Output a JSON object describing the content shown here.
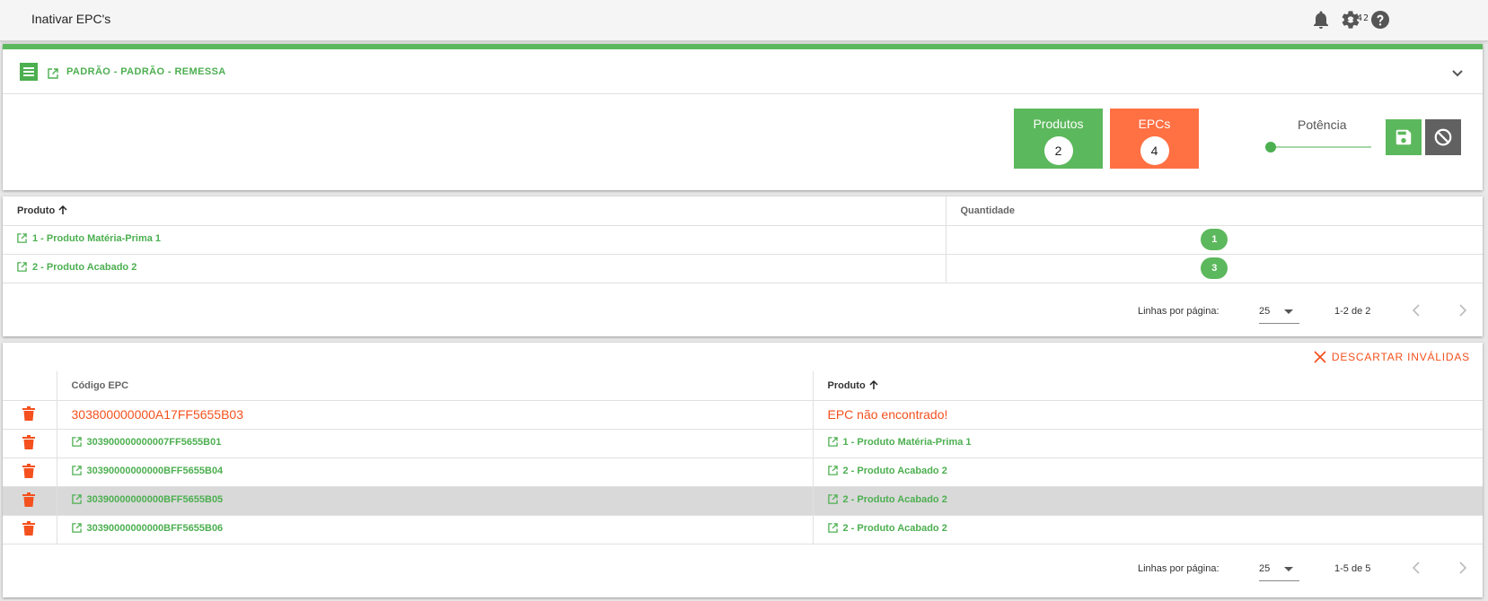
{
  "topbar": {
    "title": "Inativar EPC's",
    "version": "1.42.0",
    "icons": [
      "bell-icon",
      "gear-icon",
      "help-icon"
    ]
  },
  "document": {
    "title": "PADRÃO - PADRÃO - REMESSA",
    "counters": {
      "produtos_label": "Produtos",
      "produtos_value": "2",
      "epcs_label": "EPCs",
      "epcs_value": "4"
    },
    "potencia_label": "Potência",
    "potencia_level_fraction": 0
  },
  "products_table": {
    "col_produto": "Produto",
    "col_quantidade": "Quantidade",
    "rows": [
      {
        "produto": "1 - Produto Matéria-Prima 1",
        "quantidade": "1"
      },
      {
        "produto": "2 - Produto Acabado 2",
        "quantidade": "3"
      }
    ],
    "pager": {
      "label": "Linhas por página:",
      "per_page": "25",
      "range": "1-2 de 2"
    }
  },
  "epc_table": {
    "discard_label": "DESCARTAR INVÁLIDAS",
    "col_codigo": "Código EPC",
    "col_produto": "Produto",
    "rows": [
      {
        "codigo": "303800000000A17FF5655B03",
        "produto": "EPC não encontrado!",
        "invalid": true
      },
      {
        "codigo": "303900000000007FF5655B01",
        "produto": "1 - Produto Matéria-Prima 1",
        "invalid": false
      },
      {
        "codigo": "30390000000000BFF5655B04",
        "produto": "2 - Produto Acabado 2",
        "invalid": false
      },
      {
        "codigo": "30390000000000BFF5655B05",
        "produto": "2 - Produto Acabado 2",
        "invalid": false
      },
      {
        "codigo": "30390000000000BFF5655B06",
        "produto": "2 - Produto Acabado 2",
        "invalid": false
      }
    ],
    "pager": {
      "label": "Linhas por página:",
      "per_page": "25",
      "range": "1-5 de 5"
    }
  },
  "colors": {
    "green": "#5cb85c",
    "orange": "#ff7043",
    "grey": "#616161"
  }
}
